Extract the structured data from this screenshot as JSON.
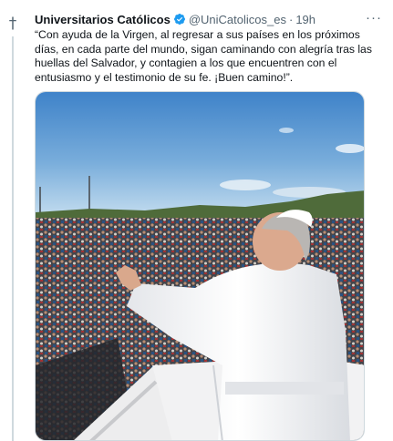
{
  "tweet": {
    "author_name": "Universitarios Católicos",
    "handle": "@UniCatolicos_es",
    "separator": "·",
    "time": "19h",
    "text": "“Con ayuda de la Virgen, al regresar a sus países en los próximos días, en cada parte del mundo, sigan caminando con alegría tras las huellas del Salvador, y contagien a los que encuentren con el entusiasmo y el testimonio de su fe. ¡Buen camino!”.",
    "avatar_glyph": "†",
    "more_glyph": "···"
  },
  "icons": {
    "avatar": "cross-logo-icon",
    "verified": "verified-badge-icon",
    "more": "more-options-icon"
  },
  "colors": {
    "verified_blue": "#1d9bf0",
    "secondary_text": "#536471",
    "sky_top": "#3f83c9",
    "sky_bottom": "#b9d6ea"
  }
}
